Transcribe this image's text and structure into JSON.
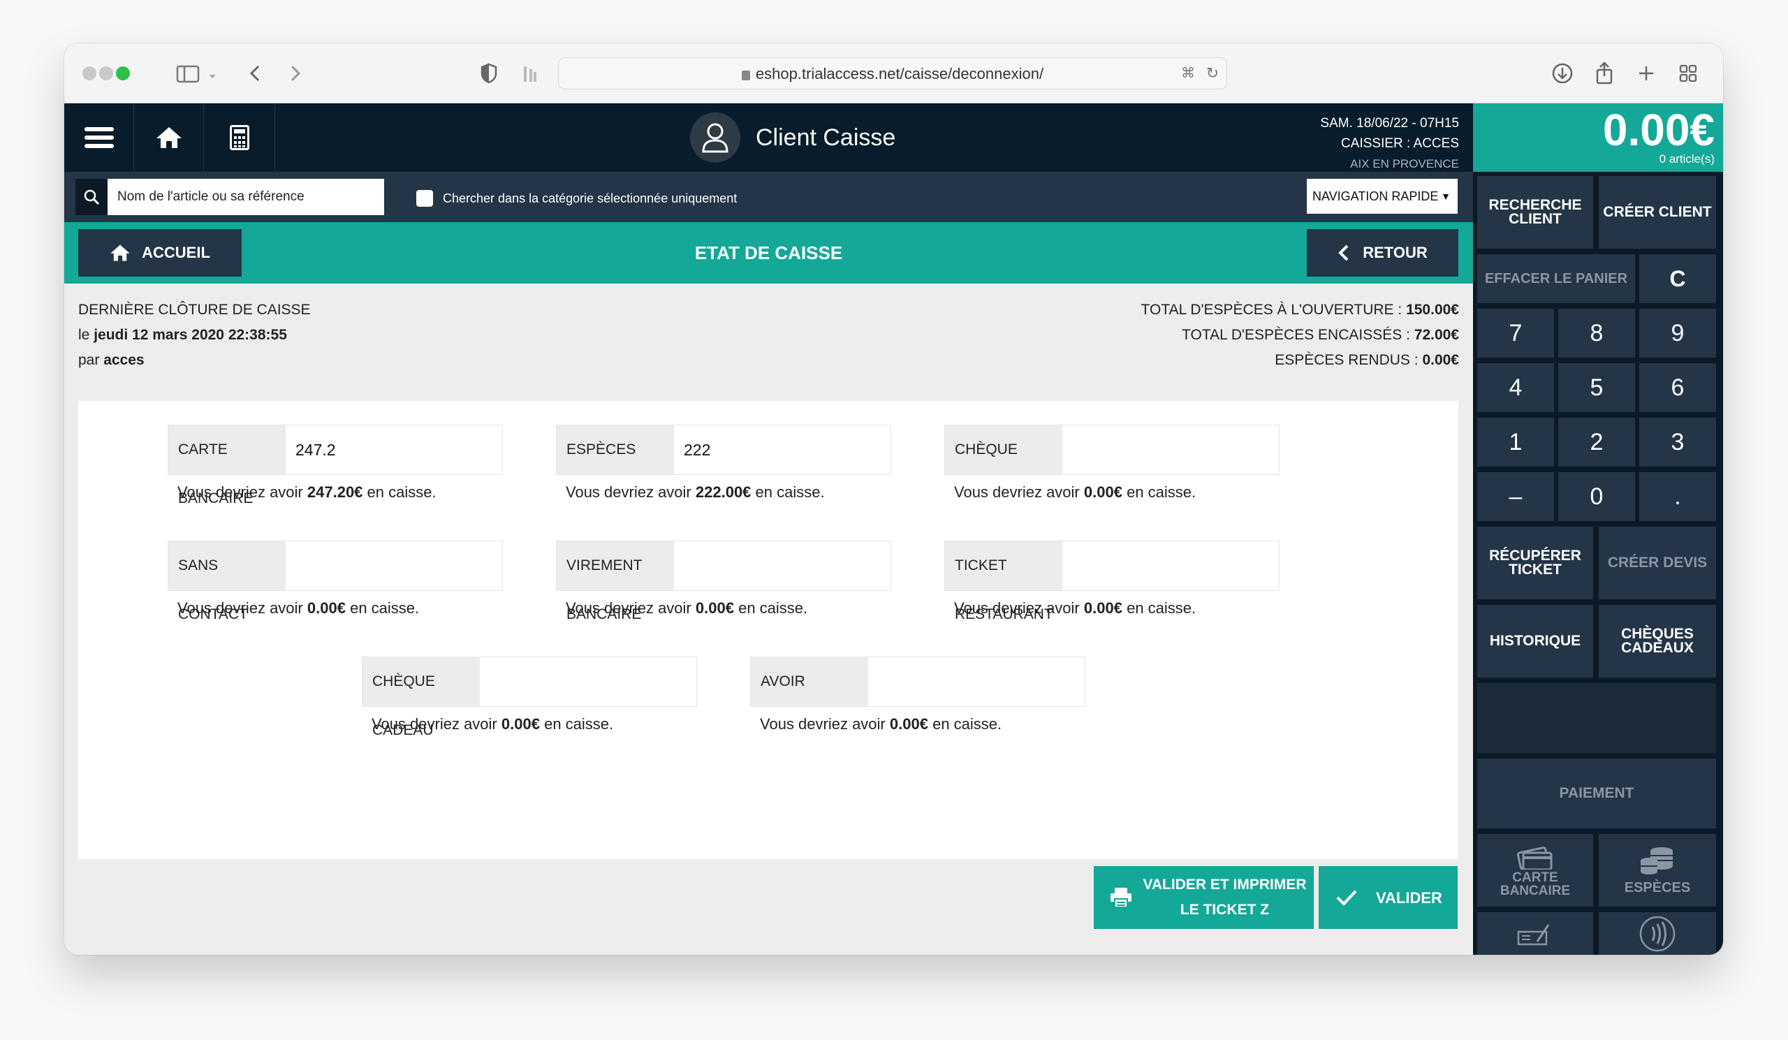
{
  "browser": {
    "url": "eshop.trialaccess.net/caisse/deconnexion/"
  },
  "header": {
    "client_name": "Client Caisse",
    "session_date": "SAM. 18/06/22 - 07H15",
    "cashier": "CAISSIER : ACCES",
    "city": "AIX EN PROVENCE",
    "total_amount": "0.00€",
    "article_count": "0 article(s)"
  },
  "search": {
    "placeholder": "Nom de l'article ou sa référence",
    "checkbox_label": "Chercher dans la catégorie sélectionnée uniquement",
    "quick_nav": "NAVIGATION RAPIDE"
  },
  "actions": {
    "home_label": "ACCUEIL",
    "page_title": "ETAT DE CAISSE",
    "back_label": "RETOUR"
  },
  "summary": {
    "last_close_title": "DERNIÈRE CLÔTURE DE CAISSE",
    "last_close_prefix": "le",
    "last_close_date": "jeudi 12 mars 2020 22:38:55",
    "by_prefix": "par",
    "by_user": "acces",
    "cash_open_label": "TOTAL D'ESPÈCES À L'OUVERTURE :",
    "cash_open_value": "150.00€",
    "cash_in_label": "TOTAL D'ESPÈCES ENCAISSÉS :",
    "cash_in_value": "72.00€",
    "cash_out_label": "ESPÈCES RENDUS :",
    "cash_out_value": "0.00€"
  },
  "payments": [
    {
      "label": "CARTE BANCAIRE",
      "value": "247.2",
      "msg_prefix": "Vous devriez avoir",
      "expected": "247.20€",
      "msg_suffix": "en caisse."
    },
    {
      "label": "ESPÈCES",
      "value": "222",
      "msg_prefix": "Vous devriez avoir",
      "expected": "222.00€",
      "msg_suffix": "en caisse."
    },
    {
      "label": "CHÈQUE",
      "value": "",
      "msg_prefix": "Vous devriez avoir",
      "expected": "0.00€",
      "msg_suffix": "en caisse."
    },
    {
      "label": "SANS CONTACT",
      "value": "",
      "msg_prefix": "Vous devriez avoir",
      "expected": "0.00€",
      "msg_suffix": "en caisse."
    },
    {
      "label": "VIREMENT BANCAIRE",
      "value": "",
      "msg_prefix": "Vous devriez avoir",
      "expected": "0.00€",
      "msg_suffix": "en caisse."
    },
    {
      "label": "TICKET RESTAURANT",
      "value": "",
      "msg_prefix": "Vous devriez avoir",
      "expected": "0.00€",
      "msg_suffix": "en caisse."
    },
    {
      "label": "CHÈQUE CADEAU",
      "value": "",
      "msg_prefix": "Vous devriez avoir",
      "expected": "0.00€",
      "msg_suffix": "en caisse."
    },
    {
      "label": "AVOIR",
      "value": "",
      "msg_prefix": "Vous devriez avoir",
      "expected": "0.00€",
      "msg_suffix": "en caisse."
    }
  ],
  "footer": {
    "validate_print_line1": "VALIDER ET IMPRIMER",
    "validate_print_line2": "LE TICKET Z",
    "validate": "VALIDER"
  },
  "keypad": {
    "search_client_1": "RECHERCHE",
    "search_client_2": "CLIENT",
    "create_client": "CRÉER CLIENT",
    "clear_cart": "EFFACER LE PANIER",
    "clear_key": "C",
    "keys": [
      "7",
      "8",
      "9",
      "4",
      "5",
      "6",
      "1",
      "2",
      "3",
      "–",
      "0",
      "."
    ],
    "recover_ticket_1": "RÉCUPÉRER",
    "recover_ticket_2": "TICKET",
    "create_quote": "CRÉER DEVIS",
    "history": "HISTORIQUE",
    "gift_cheques_1": "CHÈQUES",
    "gift_cheques_2": "CADEAUX",
    "payment": "PAIEMENT",
    "card_1": "CARTE",
    "card_2": "BANCAIRE",
    "cash": "ESPÈCES"
  },
  "colors": {
    "accent": "#13a897",
    "dark": "#081c2b",
    "panel": "#233547"
  }
}
